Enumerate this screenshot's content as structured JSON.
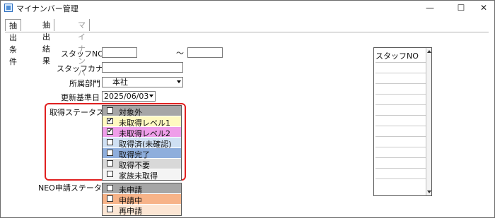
{
  "window": {
    "title": "マイナンバー管理",
    "controls": {
      "minimize": "—",
      "maximize": "☐",
      "close": "✕"
    }
  },
  "tabs": [
    {
      "label": "抽出条件",
      "active": true
    },
    {
      "label": "抽出結果",
      "active": false
    },
    {
      "label": "マイナンバー",
      "active": false,
      "disabled": true
    }
  ],
  "form": {
    "staff_no_label": "スタッフNO",
    "staff_no_from": "",
    "range_sep": "〜",
    "staff_no_to": "",
    "staff_kana_label": "スタッフカナ",
    "staff_kana": "",
    "dept_label": "所属部門",
    "dept_value": "本社",
    "update_date_label": "更新基準日",
    "update_date_value": "2025/06/03",
    "acquire_status_label": "取得ステータス",
    "acquire_status": [
      {
        "label": "対象外",
        "checked": false,
        "color": "#a6a6a6"
      },
      {
        "label": "未取得レベル1",
        "checked": true,
        "color": "#fff9c0"
      },
      {
        "label": "未取得レベル2",
        "checked": true,
        "color": "#ef9ee9"
      },
      {
        "label": "取得済(未確認)",
        "checked": false,
        "color": "#cfe0f3"
      },
      {
        "label": "取得完了",
        "checked": false,
        "color": "#8eaedc"
      },
      {
        "label": "取得不要",
        "checked": false,
        "color": "#d8d8d8"
      },
      {
        "label": "家族未取得",
        "checked": false,
        "color": "#f4f4f4"
      }
    ],
    "neo_status_label": "NEO申請ステータス",
    "neo_status": [
      {
        "label": "未申請",
        "checked": false,
        "color": "#a6a6a6"
      },
      {
        "label": "申請中",
        "checked": false,
        "color": "#f7b388"
      },
      {
        "label": "再申請",
        "checked": false,
        "color": "#fce6d4"
      }
    ]
  },
  "staff_list": {
    "header": "スタッフNO",
    "rows": [
      "",
      "",
      "",
      "",
      "",
      "",
      "",
      "",
      "",
      "",
      "",
      ""
    ]
  }
}
